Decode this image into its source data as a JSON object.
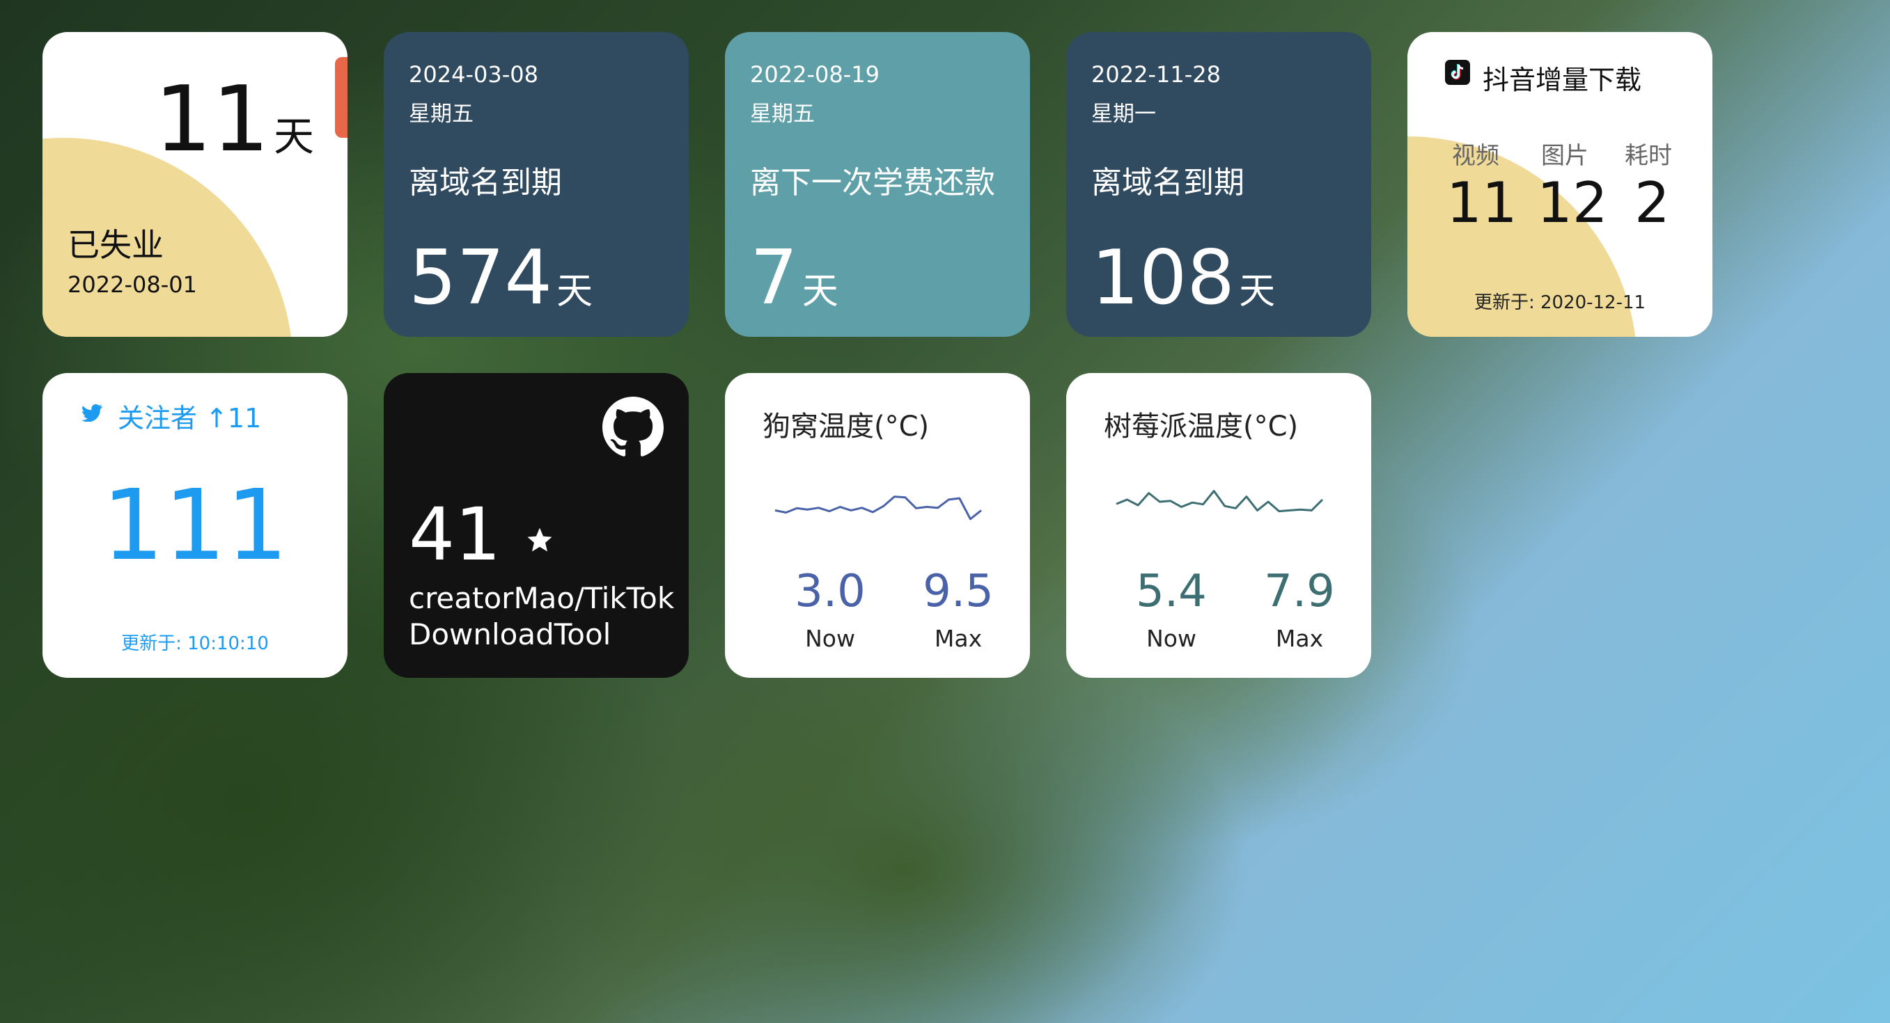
{
  "unemployed": {
    "days": "11",
    "unit": "天",
    "label": "已失业",
    "date": "2022-08-01"
  },
  "countdowns": [
    {
      "date": "2024-03-08",
      "weekday": "星期五",
      "event": "离域名到期",
      "days": "574",
      "unit": "天"
    },
    {
      "date": "2022-08-19",
      "weekday": "星期五",
      "event": "离下一次学费还款",
      "days": "7",
      "unit": "天"
    },
    {
      "date": "2022-11-28",
      "weekday": "星期一",
      "event": "离域名到期",
      "days": "108",
      "unit": "天"
    }
  ],
  "douyin": {
    "title": "抖音增量下载",
    "stats": [
      {
        "label": "视频",
        "value": "11"
      },
      {
        "label": "图片",
        "value": "12"
      },
      {
        "label": "耗时",
        "value": "2"
      }
    ],
    "updated": "更新于: 2020-12-11"
  },
  "twitter": {
    "header": "关注者 ↑11",
    "count": "111",
    "updated": "更新于: 10:10:10"
  },
  "github": {
    "stars": "41",
    "repo_line1": "creatorMao/TikTok",
    "repo_line2": "DownloadTool"
  },
  "temperatures": [
    {
      "title": "狗窝温度(°C)",
      "now": "3.0",
      "max": "9.5",
      "now_label": "Now",
      "max_label": "Max",
      "color": "#4a63a8",
      "series": [
        0.3,
        0.25,
        0.35,
        0.32,
        0.36,
        0.28,
        0.38,
        0.3,
        0.36,
        0.26,
        0.4,
        0.62,
        0.6,
        0.35,
        0.38,
        0.36,
        0.55,
        0.58,
        0.1,
        0.3
      ]
    },
    {
      "title": "树莓派温度(°C)",
      "now": "5.4",
      "max": "7.9",
      "now_label": "Now",
      "max_label": "Max",
      "color": "#3c6e72",
      "series": [
        0.45,
        0.55,
        0.42,
        0.7,
        0.5,
        0.52,
        0.38,
        0.48,
        0.44,
        0.75,
        0.4,
        0.35,
        0.62,
        0.3,
        0.5,
        0.28,
        0.3,
        0.32,
        0.3,
        0.55
      ]
    }
  ]
}
